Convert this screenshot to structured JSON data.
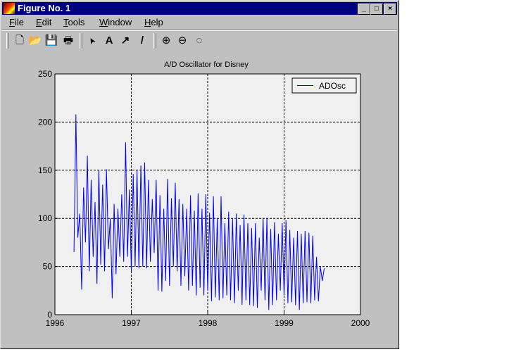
{
  "window": {
    "title": "Figure No. 1",
    "minimize": "_",
    "maximize": "□",
    "close": "×"
  },
  "menu": [
    {
      "label": "File",
      "key": "F",
      "rest": "ile"
    },
    {
      "label": "Edit",
      "key": "E",
      "rest": "dit"
    },
    {
      "label": "Tools",
      "key": "T",
      "rest": "ools"
    },
    {
      "label": "Window",
      "key": "W",
      "rest": "indow"
    },
    {
      "label": "Help",
      "key": "H",
      "rest": "elp"
    }
  ],
  "toolbar": {
    "new": "🗋",
    "open": "📂",
    "save": "💾",
    "print": "🖶",
    "arrow": "➤",
    "text": "A",
    "insert_arrow": "↗",
    "line": "/",
    "zoom_in": "⊕",
    "zoom_out": "⊖",
    "rotate": "◌"
  },
  "colors": {
    "series": "#0000ff",
    "axes_bg": "#f0f0f0",
    "figure_bg": "#c0c0c0",
    "title_bar": "#000080"
  },
  "chart_data": {
    "type": "line",
    "title": "A/D Oscillator for Disney",
    "xlabel": "",
    "ylabel": "",
    "xlim": [
      1996,
      2000
    ],
    "ylim": [
      0,
      250
    ],
    "xticks": [
      "1996",
      "1997",
      "1998",
      "1999",
      "2000"
    ],
    "yticks": [
      "0",
      "50",
      "100",
      "150",
      "200",
      "250"
    ],
    "grid": true,
    "legend": {
      "placement": "top-right",
      "entries": [
        "ADOsc"
      ]
    },
    "series": [
      {
        "name": "ADOsc",
        "x_start": 1996.25,
        "x_step": 0.025,
        "values": [
          65,
          208,
          80,
          105,
          26,
          132,
          75,
          165,
          45,
          140,
          60,
          117,
          32,
          150,
          52,
          135,
          45,
          151,
          68,
          100,
          17,
          115,
          42,
          110,
          60,
          125,
          55,
          179,
          60,
          130,
          45,
          146,
          50,
          150,
          48,
          155,
          50,
          158,
          48,
          140,
          55,
          120,
          64,
          140,
          25,
          124,
          24,
          110,
          35,
          141,
          30,
          121,
          50,
          137,
          45,
          120,
          30,
          115,
          40,
          110,
          25,
          124,
          30,
          108,
          20,
          126,
          28,
          110,
          20,
          125,
          25,
          106,
          14,
          123,
          18,
          100,
          15,
          123,
          17,
          95,
          20,
          107,
          15,
          100,
          12,
          105,
          25,
          93,
          10,
          104,
          15,
          95,
          10,
          90,
          9,
          95,
          7,
          80,
          25,
          100,
          15,
          100,
          5,
          89,
          10,
          96,
          15,
          84,
          25,
          95,
          20,
          98,
          12,
          88,
          13,
          80,
          10,
          87,
          5,
          84,
          12,
          87,
          13,
          85,
          12,
          82,
          15,
          60,
          14,
          50,
          35,
          48
        ]
      }
    ]
  }
}
